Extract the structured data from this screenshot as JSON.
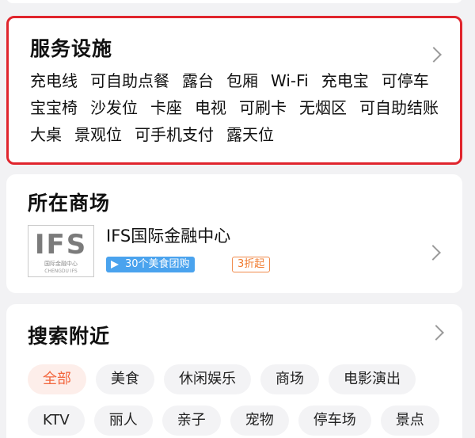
{
  "services": {
    "title": "服务设施",
    "facilities": [
      "充电线",
      "可自助点餐",
      "露台",
      "包厢",
      "Wi-Fi",
      "充电宝",
      "可停车",
      "宝宝椅",
      "沙发位",
      "卡座",
      "电视",
      "可刷卡",
      "无烟区",
      "可自助结账",
      "大桌",
      "景观位",
      "可手机支付",
      "露天位"
    ]
  },
  "mall": {
    "title": "所在商场",
    "logo_text": "IFS",
    "logo_sub1": "国际金融中心",
    "logo_sub2": "CHENGDU IFS",
    "name": "IFS国际金融中心",
    "deal_tag": "30个美食团购",
    "discount_tag": "3折起"
  },
  "nearby": {
    "title": "搜索附近",
    "row1": [
      "全部",
      "美食",
      "休闲娱乐",
      "商场",
      "电影演出"
    ],
    "row2": [
      "KTV",
      "丽人",
      "亲子",
      "宠物",
      "停车场",
      "景点"
    ],
    "active": "全部"
  },
  "colors": {
    "highlight_border": "#e0252d",
    "deal_blue": "#4aa3ee",
    "discount_orange": "#f07a2e",
    "active_chip_text": "#f2663d"
  }
}
